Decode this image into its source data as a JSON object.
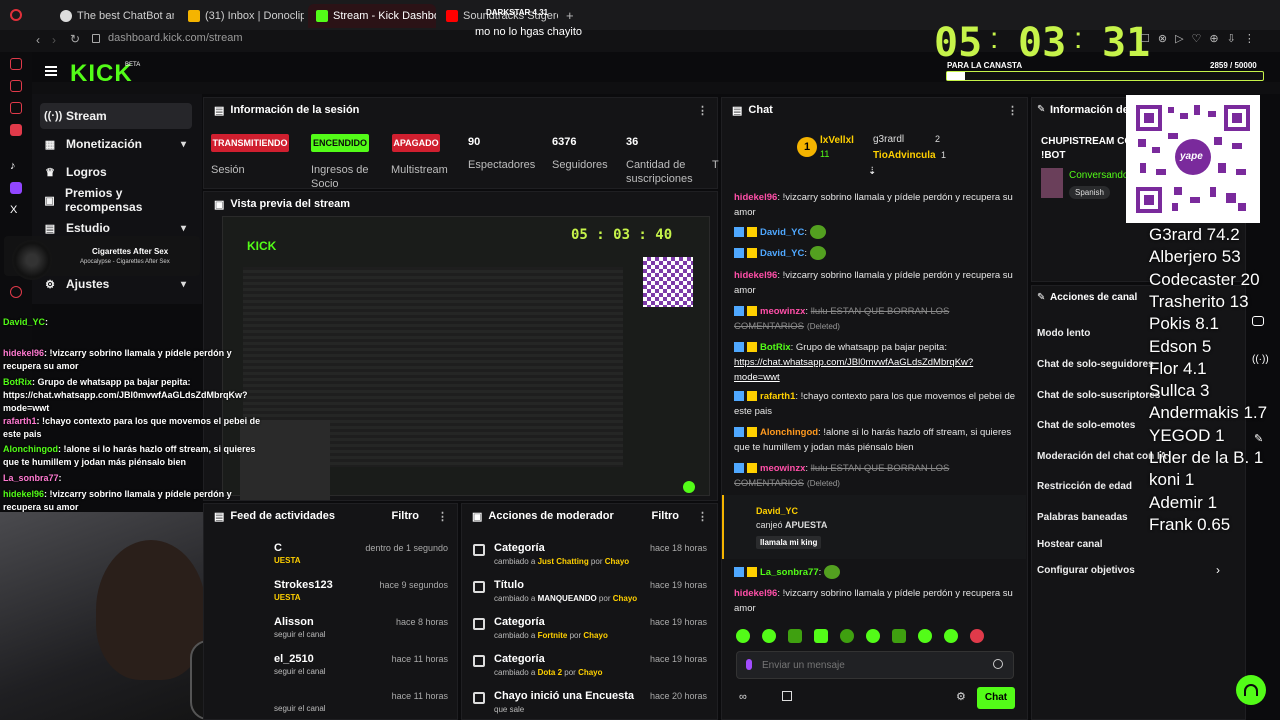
{
  "browser": {
    "tabs": [
      {
        "label": "The best ChatBot and"
      },
      {
        "label": "(31) Inbox | Donoclip"
      },
      {
        "label": "Stream - Kick Dashboard"
      },
      {
        "label": "Soundtracks Sugerencias"
      }
    ],
    "url": "dashboard.kick.com/stream",
    "overlay_title": "DARKSTAR 4.31",
    "overlay_msg": "mo no lo hgas chayito"
  },
  "timer": {
    "h": "05",
    "m": "03",
    "s": "31"
  },
  "goal": {
    "label": "PARA LA CANASTA",
    "value": "2859 / 50000",
    "progress": 0.057
  },
  "kick": {
    "logo": "KICK",
    "beta": "BETA"
  },
  "sidebar": {
    "items": [
      {
        "label": "Stream"
      },
      {
        "label": "Monetización"
      },
      {
        "label": "Logros"
      },
      {
        "label": "Premios y recompensas"
      },
      {
        "label": "Estudio"
      },
      {
        "label": "Ajustes"
      }
    ]
  },
  "music": {
    "title": "Cigarettes After Sex",
    "subtitle": "Apocalypse - Cigarettes After Sex"
  },
  "session": {
    "title": "Información de la sesión",
    "badges": [
      "TRANSMITIENDO",
      "ENCENDIDO",
      "APAGADO"
    ],
    "labels": [
      "Sesión",
      "Ingresos de Socio",
      "Multistream"
    ],
    "stats": [
      {
        "value": "90",
        "label": "Espectadores"
      },
      {
        "value": "6376",
        "label": "Seguidores"
      },
      {
        "value": "36",
        "label": "Cantidad de suscripciones"
      },
      {
        "value": "",
        "label": "T"
      }
    ]
  },
  "preview": {
    "title": "Vista previa del stream",
    "mini_timer": "05 : 03 : 40"
  },
  "activity": {
    "title": "Feed de actividades",
    "filter": "Filtro",
    "rows": [
      {
        "name": "C",
        "sub": "UESTA",
        "time": "dentro de 1 segundo"
      },
      {
        "name": "Strokes123",
        "sub": "UESTA",
        "time": "hace 9 segundos"
      },
      {
        "name": "Alisson",
        "sub": "seguir el canal",
        "time": "hace 8 horas"
      },
      {
        "name": "el_2510",
        "sub": "seguir el canal",
        "time": "hace 11 horas"
      },
      {
        "name": "",
        "sub": "seguir el canal",
        "time": "hace 11 horas"
      }
    ]
  },
  "modactions": {
    "title": "Acciones de moderador",
    "filter": "Filtro",
    "rows": [
      {
        "title": "Categoría",
        "sub_a": "cambiado a ",
        "value": "Just Chatting",
        "sub_b": " por ",
        "by": "Chayo",
        "time": "hace 18 horas"
      },
      {
        "title": "Título",
        "sub_a": "cambiado a ",
        "value": "MANQUEANDO",
        "sub_b": " por ",
        "by": "Chayo",
        "time": "hace 19 horas"
      },
      {
        "title": "Categoría",
        "sub_a": "cambiado a ",
        "value": "Fortnite",
        "sub_b": " por ",
        "by": "Chayo",
        "time": "hace 19 horas"
      },
      {
        "title": "Categoría",
        "sub_a": "cambiado a ",
        "value": "Dota 2",
        "sub_b": " por ",
        "by": "Chayo",
        "time": "hace 19 horas"
      },
      {
        "title": "Chayo inició una Encuesta",
        "sub_a": "que sale",
        "value": "",
        "sub_b": "",
        "by": "",
        "time": "hace 20 horas"
      }
    ]
  },
  "chat": {
    "title": "Chat",
    "top": [
      {
        "rank": "1",
        "name": "lxVellxl",
        "count": "11"
      },
      {
        "rank": "",
        "name": "g3rardl",
        "count": "2"
      },
      {
        "rank": "",
        "name": "TioAdvincula",
        "count": "1"
      }
    ],
    "messages": [
      {
        "user": "hidekel96",
        "text": "!vizcarry sobrino llamala y pídele perdón y recupera su amor",
        "color": "#ff4fa8"
      },
      {
        "user": "David_YC",
        "text": "",
        "color": "#4fa8ff"
      },
      {
        "user": "David_YC",
        "text": "",
        "color": "#4fa8ff"
      },
      {
        "user": "hidekel96",
        "text": "!vizcarry sobrino llamala y pídele perdón y recupera su amor",
        "color": "#ff4fa8"
      },
      {
        "user": "meowinzx",
        "text": "llulu ESTAN QUE BORRAN LOS COMENTARIOS",
        "deleted": "(Deleted)",
        "color": "#ff4fa8"
      },
      {
        "user": "BotRix",
        "text": "Grupo de whatsapp pa bajar pepita:",
        "link": "https://chat.whatsapp.com/JBl0mvwfAaGLdsZdMbrqKw?mode=wwt",
        "color": "#53fc18"
      },
      {
        "user": "rafarth1",
        "text": "!chayo contexto para los que movemos el pebei de este pais",
        "color": "#ffd000"
      },
      {
        "user": "Alonchingod",
        "text": "!alone si lo harás hazlo off stream, si quieres que te humillem y jodan más piénsalo bien",
        "color": "#ff9a1f"
      },
      {
        "user": "meowinzx",
        "text": "llulu ESTAN QUE BORRAN LOS COMENTARIOS",
        "deleted": "(Deleted)",
        "color": "#ff4fa8"
      },
      {
        "user": "La_sonbra77",
        "text": "",
        "color": "#53fc18"
      },
      {
        "user": "hidekel96",
        "text": "!vizcarry sobrino llamala y pídele perdón y recupera su amor",
        "color": "#ff4fa8"
      }
    ],
    "redeem": {
      "user": "David_YC",
      "action": "canjeó",
      "reward": "APUESTA",
      "input": "llamala mi king"
    },
    "placeholder": "Enviar un mensaje",
    "send_label": "Chat"
  },
  "overlay_chat": [
    {
      "user": "David_YC",
      "text": ""
    },
    {
      "user": "hidekel96",
      "text": "!vizcarry sobrino llamala y pídele perdón y recupera su amor"
    },
    {
      "user": "BotRix",
      "text": "Grupo de whatsapp pa bajar pepita: https://chat.whatsapp.com/JBl0mvwfAaGLdsZdMbrqKw?mode=wwt"
    },
    {
      "user": "rafarth1",
      "text": "!chayo contexto para los que movemos el pebei de este pais"
    },
    {
      "user": "Alonchingod",
      "text": "!alone si lo harás hazlo off stream, si quieres que te humillem y jodan más piénsalo bien"
    },
    {
      "user": "La_sonbra77",
      "text": ""
    },
    {
      "user": "hidekel96",
      "text": "!vizcarry sobrino llamala y pídele perdón y recupera su amor"
    }
  ],
  "right_panel": {
    "info_title": "Información del s",
    "stream_title": "CHUPISTREAM CO",
    "stream_title2": "!BOT",
    "category": "Conversando",
    "lang": "Spanish",
    "actions_title": "Acciones de canal",
    "actions": [
      "Modo lento",
      "Chat de solo-seguidores",
      "Chat de solo-suscriptores",
      "Chat de solo-emotes",
      "Moderación del chat con IA",
      "Restricción de edad",
      "Palabras baneadas",
      "Hostear canal",
      "Configurar objetivos"
    ]
  },
  "qr_label": "yape",
  "gifters": [
    "G3rard 74.2",
    "Alberjero 53",
    "Codecaster 20",
    "Trasherito 13",
    "Pokis 8.1",
    "Edson 5",
    "Flor 4.1",
    "Sullca 3",
    "Andermakis 1.7",
    "YEGOD 1",
    "Lider de la B. 1",
    "koni 1",
    "Ademir 1",
    "Frank 0.65"
  ]
}
